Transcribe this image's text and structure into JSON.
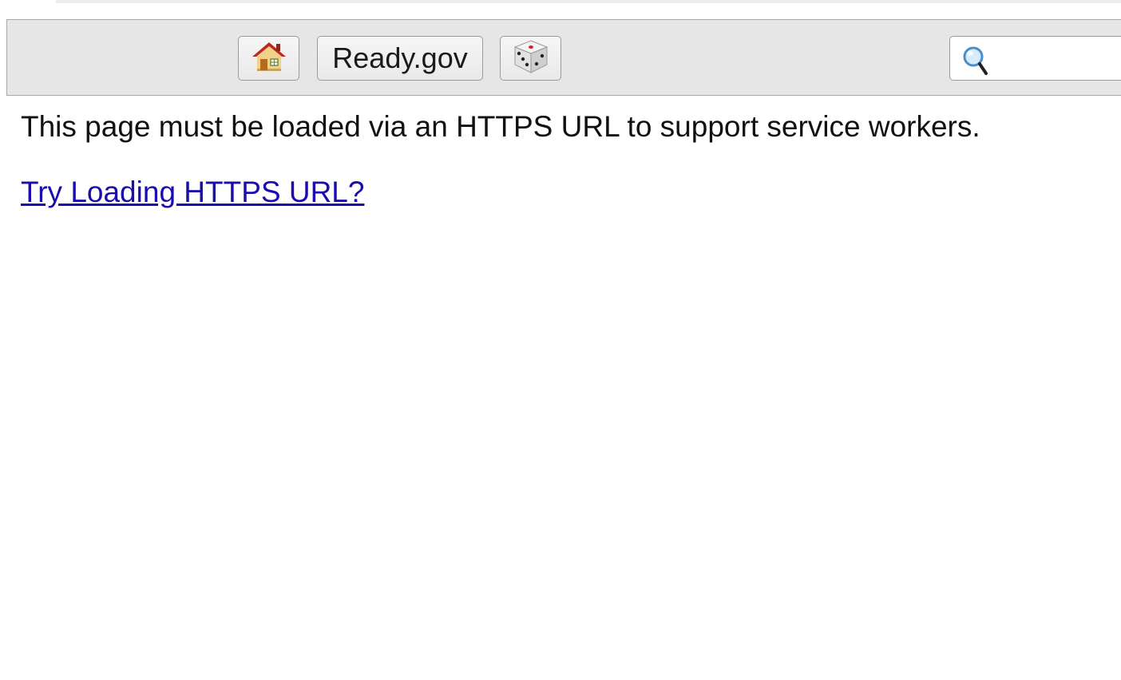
{
  "toolbar": {
    "home_button": {
      "icon": "house-icon",
      "label": ""
    },
    "site_button": {
      "label": "Ready.gov"
    },
    "random_button": {
      "icon": "dice-icon",
      "label": ""
    },
    "search": {
      "icon": "search-icon",
      "value": "",
      "placeholder": ""
    }
  },
  "content": {
    "message": "This page must be loaded via an HTTPS URL to support service workers.",
    "link_text": "Try Loading HTTPS URL?"
  },
  "colors": {
    "toolbar_bg": "#e6e6e6",
    "link": "#1a0dab",
    "text": "#111111"
  }
}
